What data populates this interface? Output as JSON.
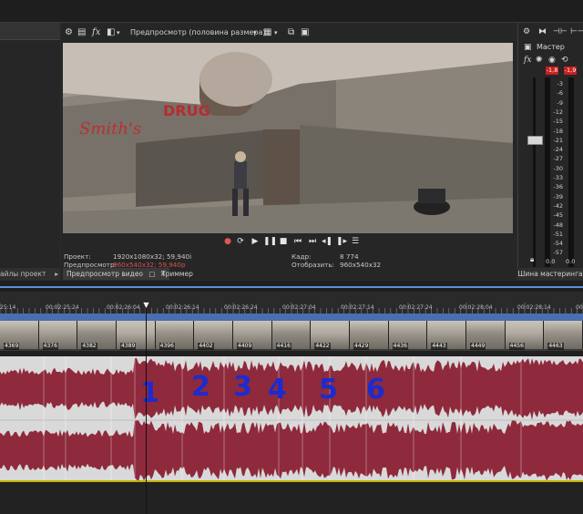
{
  "colors": {
    "background": "#2b2b2b",
    "video_track_header": "#4a6fb0",
    "waveform": "#8e2a3c",
    "waveform_background": "#d9d9d9",
    "peak_indicator": "#c81e1e",
    "annotation_number": "#1c2bd0",
    "timeline_divider": "#c9b200"
  },
  "left_pane": {
    "tab_label": "айлы проект"
  },
  "preview": {
    "toolbar": {
      "settings_icon": "gear-icon",
      "device_icon": "device-icon",
      "fx_label": "fx",
      "split_icon": "split-screen-icon",
      "quality_label": "Предпросмотр (половина размера)",
      "grid_icon": "grid-icon",
      "copy_icon": "copy-icon",
      "save_icon": "save-icon"
    },
    "transport": [
      "record-icon",
      "loop-icon",
      "play-icon",
      "pause-icon",
      "stop-icon",
      "prev-frame-icon",
      "next-frame-icon",
      "prev-marker-icon",
      "next-marker-icon",
      "menu-icon"
    ],
    "info": {
      "project_label": "Проект:",
      "project_value": "1920x1080x32; 59,940i",
      "preview_label": "Предпросмотр:",
      "preview_value": "960x540x32; 59,940p",
      "frame_label": "Кадр:",
      "frame_value": "8 774",
      "display_label": "Отобразить:",
      "display_value": "960x540x32"
    },
    "tabs": [
      {
        "label": "Предпросмотр видео"
      },
      {
        "label": "Триммер"
      }
    ],
    "frame_signs": [
      "Smith's",
      "DRUG"
    ]
  },
  "master": {
    "title": "Мастер",
    "fx_label": "fx",
    "peak_left": "-1,8",
    "peak_right": "-1,9",
    "db_scale": [
      "3",
      "6",
      "9",
      "12",
      "15",
      "18",
      "21",
      "24",
      "27",
      "30",
      "33",
      "36",
      "39",
      "42",
      "45",
      "48",
      "51",
      "54",
      "57"
    ],
    "bottom_left": "0.0",
    "bottom_right": "0.0",
    "tab_label": "Шина мастеринга"
  },
  "timeline": {
    "timecodes": [
      "25:14",
      "00:02:25:24",
      "00:02:26:04",
      "00:02:26:14",
      "00:02:26:24",
      "00:02:27:04",
      "00:02:27:14",
      "00:02:27:24",
      "00:02:28:04",
      "00:02:28:14",
      "00:02:28:24"
    ],
    "frame_numbers": [
      "4369",
      "4376",
      "4382",
      "4389",
      "4396",
      "4402",
      "4409",
      "4416",
      "4422",
      "4429",
      "4436",
      "4443",
      "4449",
      "4456",
      "4463"
    ],
    "annotations": [
      "1",
      "2",
      "3",
      "4",
      "5",
      "6"
    ]
  }
}
